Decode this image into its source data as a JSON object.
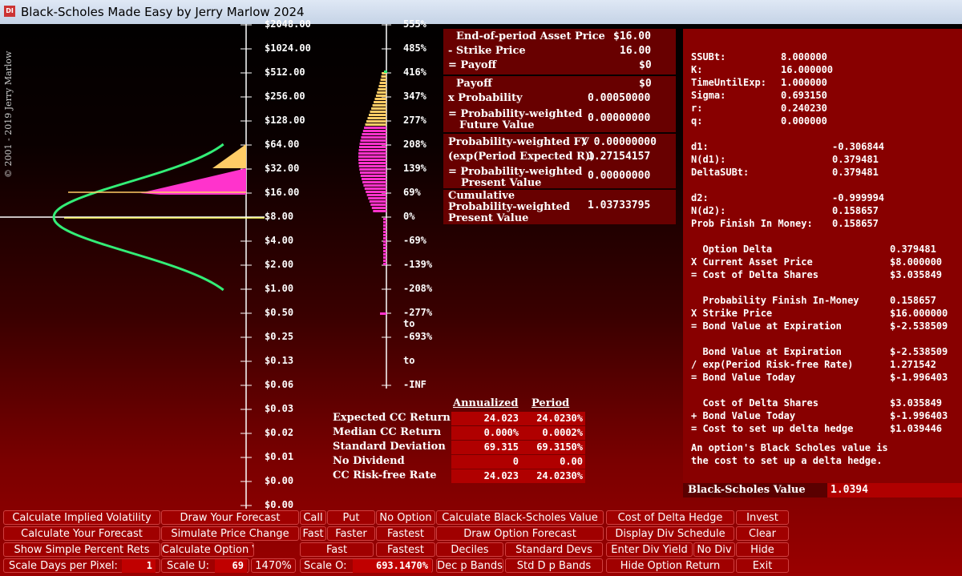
{
  "window": {
    "title": "Black-Scholes Made Easy by Jerry Marlow  2024",
    "icon": "app-icon"
  },
  "copyright": "© 2001 - 2019  Jerry Marlow",
  "price_axis": [
    "$2048.00",
    "$1024.00",
    "$512.00",
    "$256.00",
    "$128.00",
    "$64.00",
    "$32.00",
    "$16.00",
    "$8.00",
    "$4.00",
    "$2.00",
    "$1.00",
    "$0.50",
    "$0.25",
    "$0.13",
    "$0.06",
    "$0.03",
    "$0.02",
    "$0.01",
    "$0.00",
    "$0.00"
  ],
  "return_axis": [
    "555%",
    "485%",
    "416%",
    "347%",
    "277%",
    "208%",
    "139%",
    "69%",
    "0%",
    "-69%",
    "-139%",
    "-208%",
    "-277%",
    "to",
    "-693%",
    "to",
    "-INF"
  ],
  "payoff_panel": {
    "p1": {
      "asset_label": "End-of-period Asset Price",
      "asset_value": "$16.00",
      "strike_label": "- Strike Price",
      "strike_value": "16.00",
      "payoff_label": "= Payoff",
      "payoff_value": "$0"
    },
    "p2": {
      "payoff_label": "Payoff",
      "payoff_value": "$0",
      "prob_label": "x Probability",
      "prob_value": "0.00050000",
      "pwfv_label1": "= Probability-weighted",
      "pwfv_label2": "Future Value",
      "pwfv_value": "0.00000000"
    },
    "p3": {
      "pwfv_label": "Probability-weighted FV",
      "pwfv_value": "/ 0.00000000",
      "exp_label": "(exp(Period Expected R))",
      "exp_value": "1.27154157",
      "pwpv_label1": "= Probability-weighted",
      "pwpv_label2": "Present Value",
      "pwpv_value": "0.00000000"
    },
    "p4": {
      "label1": "Cumulative",
      "label2": "Probability-weighted",
      "label3": "Present Value",
      "value": "1.03733795"
    }
  },
  "stats": {
    "header_annual": "Annualized",
    "header_period": "Period",
    "rows": [
      {
        "label": "Expected CC Return",
        "annual": "24.023",
        "period": "24.0230%"
      },
      {
        "label": "Median CC Return",
        "annual": "0.000%",
        "period": "0.0002%"
      },
      {
        "label": "Standard Deviation",
        "annual": "69.315",
        "period": "69.3150%"
      },
      {
        "label": "No Dividend",
        "annual": "0",
        "period": "0.00"
      },
      {
        "label": "CC Risk-free Rate",
        "annual": "24.023",
        "period": "24.0230%"
      }
    ]
  },
  "right_panel": [
    {
      "l": "SSUBt:",
      "v": "8.000000"
    },
    {
      "l": "K:",
      "v": "16.000000"
    },
    {
      "l": "TimeUntilExp:",
      "v": "1.000000"
    },
    {
      "l": "Sigma:",
      "v": "0.693150"
    },
    {
      "l": "r:",
      "v": "0.240230"
    },
    {
      "l": "q:",
      "v": "0.000000"
    },
    {
      "l": "d1:",
      "v": "-0.306844"
    },
    {
      "l": "N(d1):",
      "v": "0.379481"
    },
    {
      "l": "DeltaSUBt:",
      "v": "0.379481"
    },
    {
      "l": "d2:",
      "v": "-0.999994"
    },
    {
      "l": "N(d2):",
      "v": "0.158657"
    },
    {
      "l": "Prob Finish In Money:",
      "v": "0.158657"
    },
    {
      "l": "  Option Delta",
      "v": "0.379481"
    },
    {
      "l": "X Current Asset Price",
      "v": "$8.000000"
    },
    {
      "l": "= Cost of Delta Shares",
      "v": "$3.035849"
    },
    {
      "l": "  Probability Finish In-Money",
      "v": "0.158657"
    },
    {
      "l": "X Strike Price",
      "v": "$16.000000"
    },
    {
      "l": "= Bond Value at Expiration",
      "v": "$-2.538509"
    },
    {
      "l": "  Bond Value at Expiration",
      "v": "$-2.538509"
    },
    {
      "l": "/ exp(Period Risk-free Rate)",
      "v": "1.271542"
    },
    {
      "l": "= Bond Value Today",
      "v": "$-1.996403"
    },
    {
      "l": "  Cost of Delta Shares",
      "v": "$3.035849"
    },
    {
      "l": "+ Bond Value Today",
      "v": "$-1.996403"
    },
    {
      "l": "= Cost to set up delta hedge",
      "v": "$1.039446"
    }
  ],
  "right_note": [
    "An option's Black Scholes value is",
    "the cost to set up a delta hedge."
  ],
  "bs_value": {
    "label": "Black-Scholes Value",
    "value": "1.0394"
  },
  "buttons": {
    "row1": [
      "Calculate Implied Volatility",
      "Draw Your Forecast",
      "Call",
      "Put",
      "No Option",
      "Calculate Black-Scholes Value",
      "Cost of Delta Hedge",
      "Invest"
    ],
    "row2": [
      "Calculate Your Forecast",
      "Simulate Price Change",
      "Fast",
      "Faster",
      "Fastest",
      "Draw Option Forecast",
      "Display Div Schedule",
      "Clear"
    ],
    "row3": [
      "Show Simple Percent Rets",
      "Calculate Option Value",
      "Fast",
      "Fastest",
      "Deciles",
      "Standard Devs",
      "Enter Div Yield",
      "No Div",
      "Hide"
    ],
    "row4": [
      "Dec p Bands",
      "Std D p Bands",
      "Hide Option Return",
      "Exit"
    ]
  },
  "fields": {
    "scale_days_label": "Scale Days per Pixel:",
    "scale_days_value": "1",
    "scale_u_label": "Scale U:",
    "scale_u_value": "69",
    "scale_u_pct": "1470%",
    "scale_o_label": "Scale O:",
    "scale_o_value": "693.1470%"
  },
  "colors": {
    "curve": "#33ee77",
    "payoff": "#ff33cc",
    "gain": "#ffcc66",
    "current_line": "#ffff66"
  }
}
